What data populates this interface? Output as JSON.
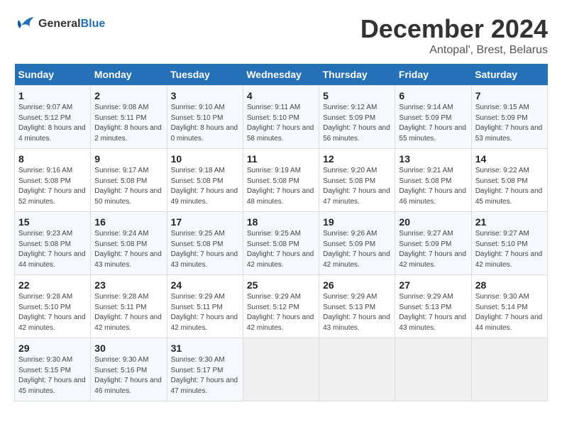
{
  "header": {
    "logo_line1": "General",
    "logo_line2": "Blue",
    "title": "December 2024",
    "subtitle": "Antopal', Brest, Belarus"
  },
  "columns": [
    "Sunday",
    "Monday",
    "Tuesday",
    "Wednesday",
    "Thursday",
    "Friday",
    "Saturday"
  ],
  "rows": [
    [
      {
        "day": "1",
        "sunrise": "Sunrise: 9:07 AM",
        "sunset": "Sunset: 5:12 PM",
        "daylight": "Daylight: 8 hours and 4 minutes."
      },
      {
        "day": "2",
        "sunrise": "Sunrise: 9:08 AM",
        "sunset": "Sunset: 5:11 PM",
        "daylight": "Daylight: 8 hours and 2 minutes."
      },
      {
        "day": "3",
        "sunrise": "Sunrise: 9:10 AM",
        "sunset": "Sunset: 5:10 PM",
        "daylight": "Daylight: 8 hours and 0 minutes."
      },
      {
        "day": "4",
        "sunrise": "Sunrise: 9:11 AM",
        "sunset": "Sunset: 5:10 PM",
        "daylight": "Daylight: 7 hours and 58 minutes."
      },
      {
        "day": "5",
        "sunrise": "Sunrise: 9:12 AM",
        "sunset": "Sunset: 5:09 PM",
        "daylight": "Daylight: 7 hours and 56 minutes."
      },
      {
        "day": "6",
        "sunrise": "Sunrise: 9:14 AM",
        "sunset": "Sunset: 5:09 PM",
        "daylight": "Daylight: 7 hours and 55 minutes."
      },
      {
        "day": "7",
        "sunrise": "Sunrise: 9:15 AM",
        "sunset": "Sunset: 5:09 PM",
        "daylight": "Daylight: 7 hours and 53 minutes."
      }
    ],
    [
      {
        "day": "8",
        "sunrise": "Sunrise: 9:16 AM",
        "sunset": "Sunset: 5:08 PM",
        "daylight": "Daylight: 7 hours and 52 minutes."
      },
      {
        "day": "9",
        "sunrise": "Sunrise: 9:17 AM",
        "sunset": "Sunset: 5:08 PM",
        "daylight": "Daylight: 7 hours and 50 minutes."
      },
      {
        "day": "10",
        "sunrise": "Sunrise: 9:18 AM",
        "sunset": "Sunset: 5:08 PM",
        "daylight": "Daylight: 7 hours and 49 minutes."
      },
      {
        "day": "11",
        "sunrise": "Sunrise: 9:19 AM",
        "sunset": "Sunset: 5:08 PM",
        "daylight": "Daylight: 7 hours and 48 minutes."
      },
      {
        "day": "12",
        "sunrise": "Sunrise: 9:20 AM",
        "sunset": "Sunset: 5:08 PM",
        "daylight": "Daylight: 7 hours and 47 minutes."
      },
      {
        "day": "13",
        "sunrise": "Sunrise: 9:21 AM",
        "sunset": "Sunset: 5:08 PM",
        "daylight": "Daylight: 7 hours and 46 minutes."
      },
      {
        "day": "14",
        "sunrise": "Sunrise: 9:22 AM",
        "sunset": "Sunset: 5:08 PM",
        "daylight": "Daylight: 7 hours and 45 minutes."
      }
    ],
    [
      {
        "day": "15",
        "sunrise": "Sunrise: 9:23 AM",
        "sunset": "Sunset: 5:08 PM",
        "daylight": "Daylight: 7 hours and 44 minutes."
      },
      {
        "day": "16",
        "sunrise": "Sunrise: 9:24 AM",
        "sunset": "Sunset: 5:08 PM",
        "daylight": "Daylight: 7 hours and 43 minutes."
      },
      {
        "day": "17",
        "sunrise": "Sunrise: 9:25 AM",
        "sunset": "Sunset: 5:08 PM",
        "daylight": "Daylight: 7 hours and 43 minutes."
      },
      {
        "day": "18",
        "sunrise": "Sunrise: 9:25 AM",
        "sunset": "Sunset: 5:08 PM",
        "daylight": "Daylight: 7 hours and 42 minutes."
      },
      {
        "day": "19",
        "sunrise": "Sunrise: 9:26 AM",
        "sunset": "Sunset: 5:09 PM",
        "daylight": "Daylight: 7 hours and 42 minutes."
      },
      {
        "day": "20",
        "sunrise": "Sunrise: 9:27 AM",
        "sunset": "Sunset: 5:09 PM",
        "daylight": "Daylight: 7 hours and 42 minutes."
      },
      {
        "day": "21",
        "sunrise": "Sunrise: 9:27 AM",
        "sunset": "Sunset: 5:10 PM",
        "daylight": "Daylight: 7 hours and 42 minutes."
      }
    ],
    [
      {
        "day": "22",
        "sunrise": "Sunrise: 9:28 AM",
        "sunset": "Sunset: 5:10 PM",
        "daylight": "Daylight: 7 hours and 42 minutes."
      },
      {
        "day": "23",
        "sunrise": "Sunrise: 9:28 AM",
        "sunset": "Sunset: 5:11 PM",
        "daylight": "Daylight: 7 hours and 42 minutes."
      },
      {
        "day": "24",
        "sunrise": "Sunrise: 9:29 AM",
        "sunset": "Sunset: 5:11 PM",
        "daylight": "Daylight: 7 hours and 42 minutes."
      },
      {
        "day": "25",
        "sunrise": "Sunrise: 9:29 AM",
        "sunset": "Sunset: 5:12 PM",
        "daylight": "Daylight: 7 hours and 42 minutes."
      },
      {
        "day": "26",
        "sunrise": "Sunrise: 9:29 AM",
        "sunset": "Sunset: 5:13 PM",
        "daylight": "Daylight: 7 hours and 43 minutes."
      },
      {
        "day": "27",
        "sunrise": "Sunrise: 9:29 AM",
        "sunset": "Sunset: 5:13 PM",
        "daylight": "Daylight: 7 hours and 43 minutes."
      },
      {
        "day": "28",
        "sunrise": "Sunrise: 9:30 AM",
        "sunset": "Sunset: 5:14 PM",
        "daylight": "Daylight: 7 hours and 44 minutes."
      }
    ],
    [
      {
        "day": "29",
        "sunrise": "Sunrise: 9:30 AM",
        "sunset": "Sunset: 5:15 PM",
        "daylight": "Daylight: 7 hours and 45 minutes."
      },
      {
        "day": "30",
        "sunrise": "Sunrise: 9:30 AM",
        "sunset": "Sunset: 5:16 PM",
        "daylight": "Daylight: 7 hours and 46 minutes."
      },
      {
        "day": "31",
        "sunrise": "Sunrise: 9:30 AM",
        "sunset": "Sunset: 5:17 PM",
        "daylight": "Daylight: 7 hours and 47 minutes."
      },
      null,
      null,
      null,
      null
    ]
  ]
}
